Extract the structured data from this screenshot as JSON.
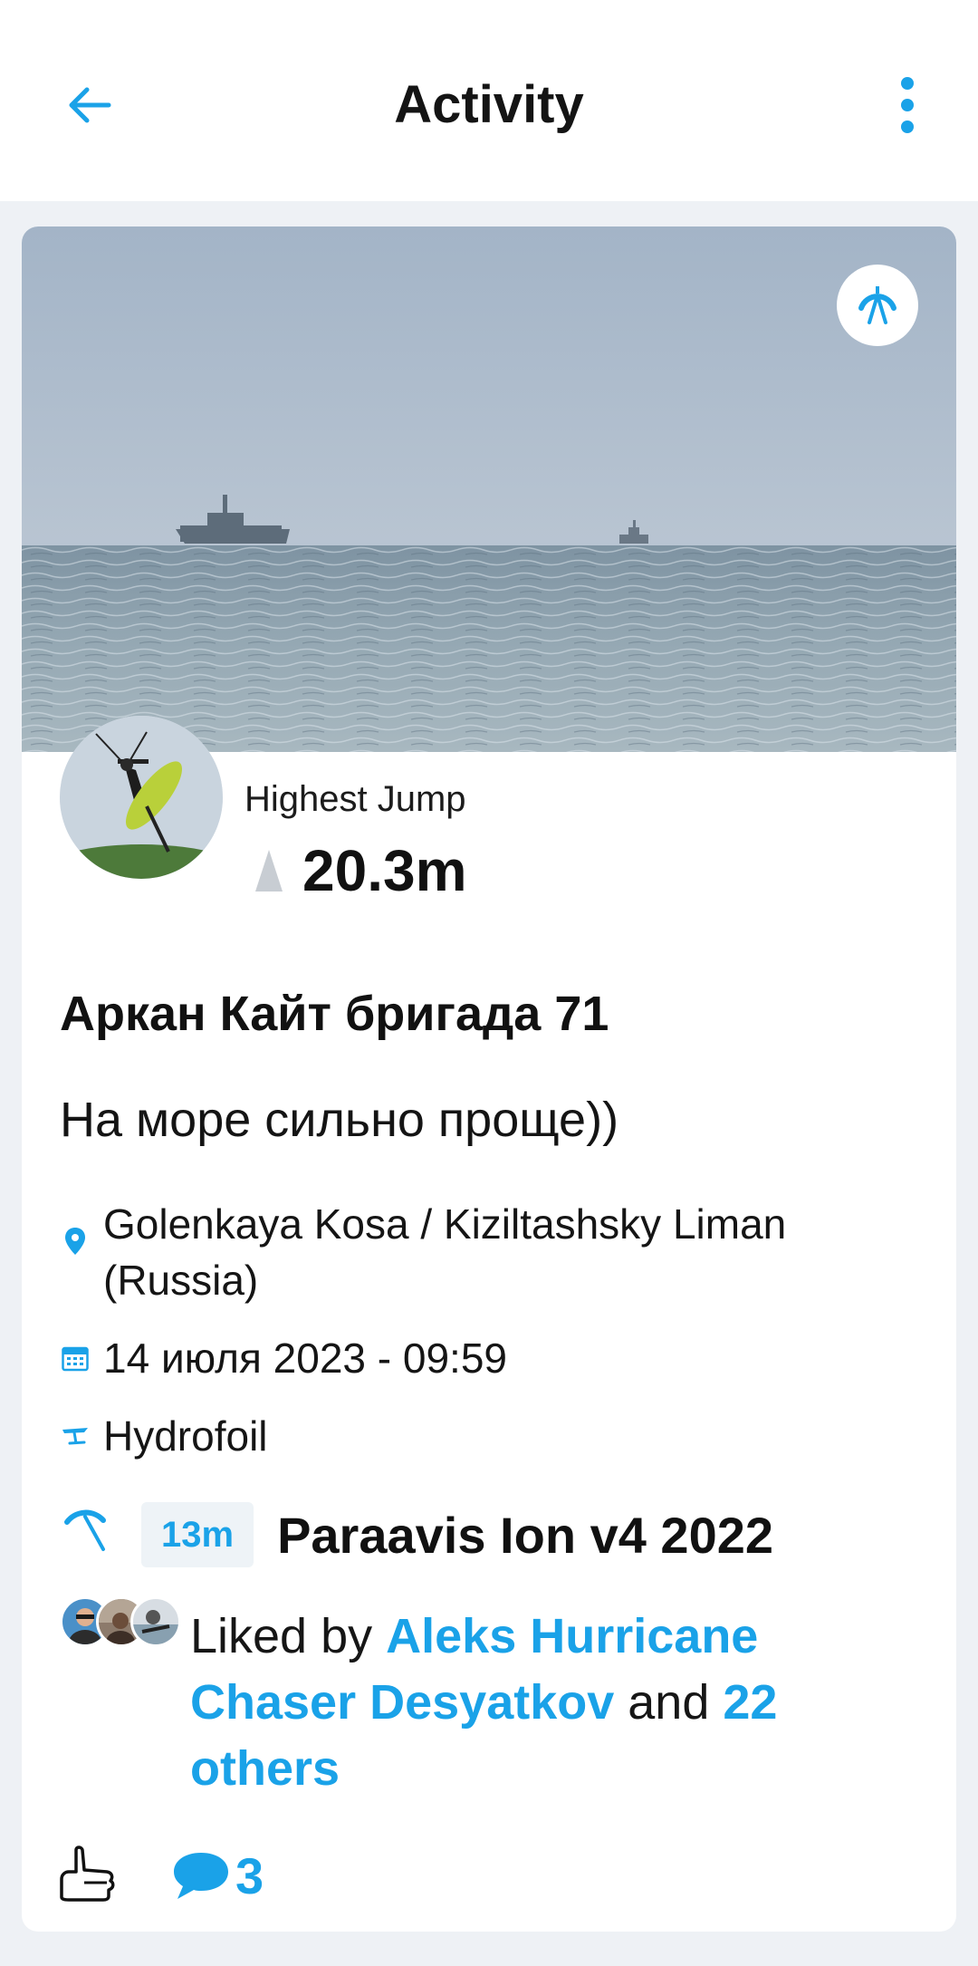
{
  "header": {
    "title": "Activity"
  },
  "session": {
    "metric_label": "Highest Jump",
    "metric_value": "20.3m",
    "title": "Аркан Кайт бригада 71",
    "description": "На море сильно проще))",
    "location": "Golenkaya Kosa / Kiziltashsky Liman (Russia)",
    "datetime": "14 июля 2023 - 09:59",
    "sport": "Hydrofoil",
    "gear": {
      "size": "13m",
      "name": "Paraavis Ion v4 2022"
    }
  },
  "likes": {
    "prefix": "Liked by ",
    "user": "Aleks Hurricane Chaser Desyatkov",
    "conjunction": " and ",
    "others": "22 others"
  },
  "comments": {
    "count": "3"
  },
  "colors": {
    "accent": "#1aa2e8",
    "background": "#eef1f5",
    "card": "#ffffff"
  },
  "icons": {
    "back": "arrow-left-icon",
    "more": "more-vertical-icon",
    "sport_badge": "kite-icon",
    "location": "map-pin-icon",
    "date": "calendar-icon",
    "sport": "hydrofoil-icon",
    "gear": "kite-icon",
    "like": "thumbs-up-icon",
    "comment": "comment-icon"
  }
}
